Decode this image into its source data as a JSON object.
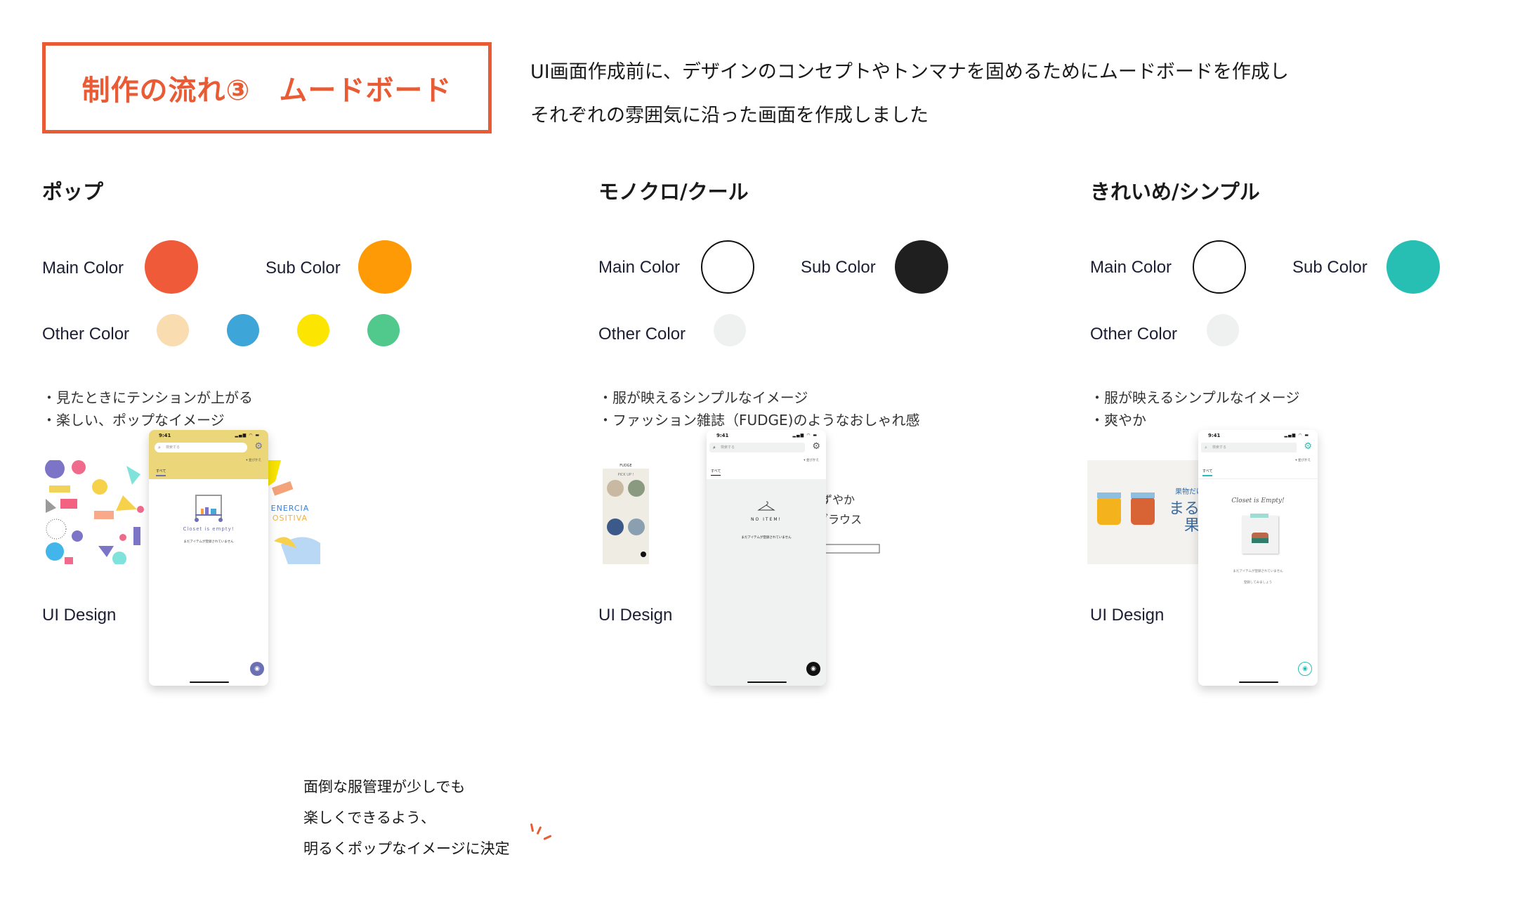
{
  "header": {
    "title": "制作の流れ③　ムードボード",
    "intro_lines": [
      "UI画面作成前に、デザインのコンセプトやトンマナを固めるためにムードボードを作成し",
      "それぞれの雰囲気に沿った画面を作成しました"
    ],
    "accent_color": "#e95b35"
  },
  "labels": {
    "main_color": "Main Color",
    "sub_color": "Sub Color",
    "other_color": "Other Color",
    "ui_design": "UI Design"
  },
  "sections": [
    {
      "title": "ポップ",
      "main_color": "#ef5a38",
      "sub_color": "#fd9a06",
      "other_colors": [
        "#f9dcb0",
        "#3ea5d8",
        "#fce500",
        "#52c98c"
      ],
      "bullets": [
        "・見たときにテンションが上がる",
        "・楽しい、ポップなイメージ"
      ],
      "references": [
        "pastel-geometric-pattern",
        "taiwan-summer-drink-poster",
        "energia-positiva-poster"
      ],
      "phone": {
        "time": "9:41",
        "search_placeholder": "検索する",
        "sort_label": "▾ 並びかえ",
        "tab": "すべて",
        "empty_title": "Closet is empty!",
        "empty_sub": "まだアイテムが登録されていません",
        "header_color": "#ecd67a",
        "accent": "#6b6fb3"
      }
    },
    {
      "title": "モノクロ/クール",
      "main_color": "#ffffff",
      "sub_color": "#1f1f1f",
      "other_colors": [
        "#eff1f1"
      ],
      "bullets": [
        "・服が映えるシンプルなイメージ",
        "・ファッション雑誌（FUDGE)のようなおしゃれ感"
      ],
      "references": [
        "fudge-app-screen",
        "suzuyaka-blouse-banner"
      ],
      "phone": {
        "time": "9:41",
        "search_placeholder": "検索する",
        "sort_label": "▾ 並びかえ",
        "tab": "すべて",
        "empty_title": "NO ITEM!",
        "empty_sub": "まだアイテムが登録されていません",
        "header_color": "#ffffff",
        "accent": "#111111"
      }
    },
    {
      "title": "きれいめ/シンプル",
      "main_color": "#ffffff",
      "sub_color": "#27bfb3",
      "other_colors": [
        "#eff1f1"
      ],
      "bullets": [
        "・服が映えるシンプルなイメージ",
        "・爽やか"
      ],
      "references": [
        "marugoto-kajitsu-jam-banner"
      ],
      "phone": {
        "time": "9:41",
        "search_placeholder": "検索する",
        "sort_label": "▾ 並びかえ",
        "tab": "すべて",
        "empty_title": "Closet is Empty!",
        "empty_sub": "まだアイテムが登録されていません",
        "empty_sub2": "登録してみましょう",
        "header_color": "#ffffff",
        "accent": "#27bfb3"
      }
    }
  ],
  "conclusion": [
    "面倒な服管理が少しでも",
    "楽しくできるよう、",
    "明るくポップなイメージに決定"
  ]
}
